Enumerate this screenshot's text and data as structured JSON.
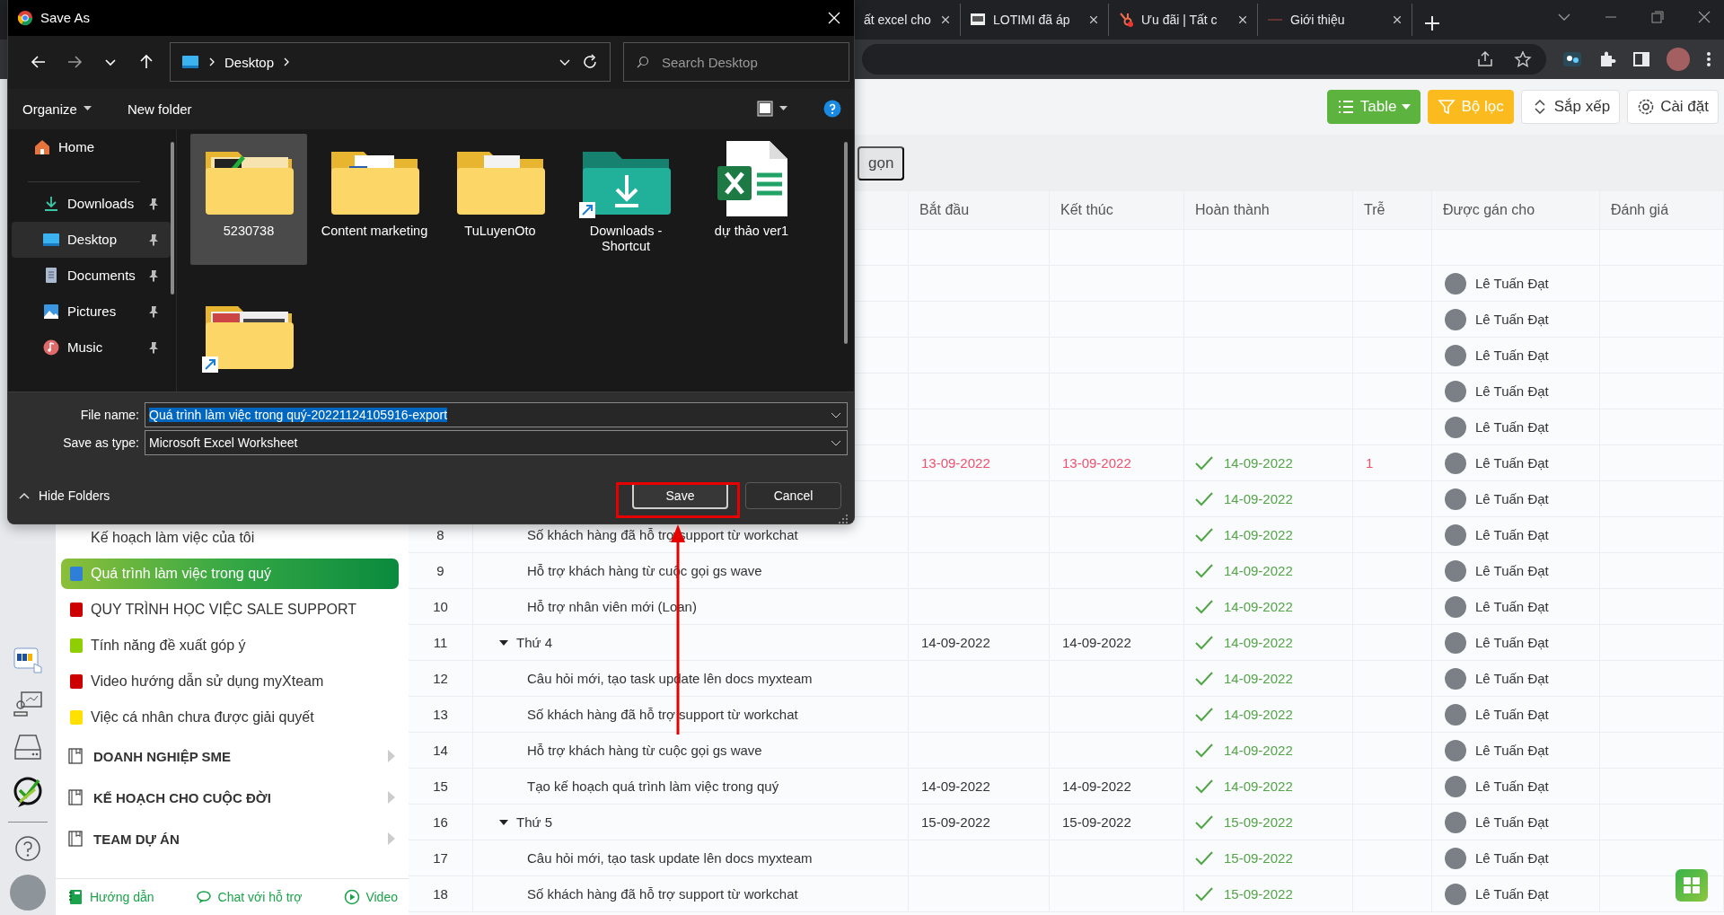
{
  "browser": {
    "tabs": [
      {
        "title": "ất excel cho",
        "selected": false
      },
      {
        "title": "LOTIMI đã áp",
        "selected": false
      },
      {
        "title": "Ưu đãi | Tất c",
        "selected": false
      },
      {
        "title": "Giới thiệu",
        "selected": false
      }
    ]
  },
  "app": {
    "toolbar": [
      {
        "label": "Table",
        "kind": "primary",
        "caret": true
      },
      {
        "label": "Bộ lọc",
        "kind": "warning",
        "caret": false
      },
      {
        "label": "Sắp xếp",
        "kind": "default",
        "caret": false
      },
      {
        "label": "Cài đặt",
        "kind": "default",
        "caret": false
      }
    ],
    "collapse_button": "gọn",
    "sidebar": {
      "items": [
        {
          "label": "Kế hoạch làm việc của tôi",
          "selected": false
        },
        {
          "label": "Quá trình làm việc trong quý",
          "color": "#2f7fd8",
          "selected": true
        },
        {
          "label": "QUY TRÌNH HỌC VIỆC SALE SUPPORT",
          "color": "#cc0000",
          "selected": false
        },
        {
          "label": "Tính năng đề xuất góp ý",
          "color": "#8fce00",
          "selected": false
        },
        {
          "label": "Video hướng dẫn sử dụng myXteam",
          "color": "#cc0000",
          "selected": false
        },
        {
          "label": "Việc cá nhân chưa được giải quyết",
          "color": "#ffe000",
          "selected": false
        }
      ],
      "sections": [
        {
          "label": "DOANH NGHIỆP SME",
          "expanded": false
        },
        {
          "label": "KẾ HOẠCH CHO CUỘC ĐỜI",
          "expanded": false
        },
        {
          "label": "TEAM DỰ ÁN",
          "expanded": false
        }
      ],
      "footer": [
        {
          "label": "Hướng dẫn"
        },
        {
          "label": "Chat với hỗ trợ"
        },
        {
          "label": "Video"
        }
      ]
    },
    "table": {
      "columns": [
        "Bắt đầu",
        "Kết thúc",
        "Hoàn thành",
        "Trễ",
        "Được gán cho",
        "Đánh giá"
      ],
      "rows": [
        {
          "kind": "task"
        },
        {
          "kind": "task",
          "assignee": "Lê Tuấn Đạt"
        },
        {
          "kind": "task",
          "assignee": "Lê Tuấn Đạt"
        },
        {
          "kind": "task",
          "assignee": "Lê Tuấn Đạt"
        },
        {
          "kind": "task",
          "assignee": "Lê Tuấn Đạt"
        },
        {
          "kind": "task",
          "assignee": "Lê Tuấn Đạt"
        },
        {
          "kind": "task",
          "start": "13-09-2022",
          "end": "13-09-2022",
          "overdue": true,
          "done": "14-09-2022",
          "late": "1",
          "assignee": "Lê Tuấn Đạt"
        },
        {
          "kind": "task",
          "done": "14-09-2022",
          "assignee": "Lê Tuấn Đạt"
        },
        {
          "kind": "task",
          "number": "8",
          "name": "Số khách hàng đã hỗ trợ support từ workchat",
          "done": "14-09-2022",
          "assignee": "Lê Tuấn Đạt"
        },
        {
          "kind": "task",
          "number": "9",
          "name": "Hỗ trợ khách hàng từ cuộc gọi gs wave",
          "done": "14-09-2022",
          "assignee": "Lê Tuấn Đạt"
        },
        {
          "kind": "task",
          "number": "10",
          "name": "Hỗ trợ nhân viên mới (Loan)",
          "done": "14-09-2022",
          "assignee": "Lê Tuấn Đạt"
        },
        {
          "kind": "group",
          "number": "11",
          "name": "Thứ 4",
          "expanded": true,
          "start": "14-09-2022",
          "end": "14-09-2022",
          "overdue": false,
          "done": "14-09-2022",
          "assignee": "Lê Tuấn Đạt"
        },
        {
          "kind": "task",
          "number": "12",
          "name": "Câu hỏi mới, tạo task update lên docs myxteam",
          "done": "14-09-2022",
          "assignee": "Lê Tuấn Đạt"
        },
        {
          "kind": "task",
          "number": "13",
          "name": "Số khách hàng đã hỗ trợ support từ workchat",
          "done": "14-09-2022",
          "assignee": "Lê Tuấn Đạt"
        },
        {
          "kind": "task",
          "number": "14",
          "name": "Hỗ trợ khách hàng từ cuộc gọi gs wave",
          "done": "14-09-2022",
          "assignee": "Lê Tuấn Đạt"
        },
        {
          "kind": "task",
          "number": "15",
          "name": "Tạo kế hoạch quá trình làm việc trong quý",
          "start": "14-09-2022",
          "end": "14-09-2022",
          "overdue": false,
          "done": "14-09-2022",
          "assignee": "Lê Tuấn Đạt"
        },
        {
          "kind": "group",
          "number": "16",
          "name": "Thứ 5",
          "expanded": true,
          "start": "15-09-2022",
          "end": "15-09-2022",
          "overdue": false,
          "done": "15-09-2022",
          "assignee": "Lê Tuấn Đạt"
        },
        {
          "kind": "task",
          "number": "17",
          "name": "Câu hỏi mới, tạo task update lên docs myxteam",
          "done": "15-09-2022",
          "assignee": "Lê Tuấn Đạt"
        },
        {
          "kind": "task",
          "number": "18",
          "name": "Số khách hàng đã hỗ trợ support từ workchat",
          "done": "15-09-2022",
          "assignee": "Lê Tuấn Đạt"
        }
      ]
    }
  },
  "dialog": {
    "title": "Save As",
    "path": [
      "Desktop"
    ],
    "search": {
      "placeholder": "Search Desktop"
    },
    "commands": [
      {
        "label": "Organize",
        "menu": true
      },
      {
        "label": "New folder",
        "menu": false
      }
    ],
    "nav": [
      {
        "label": "Home",
        "pinned": false,
        "selected": false
      },
      {
        "label": "Downloads",
        "pinned": true,
        "selected": false
      },
      {
        "label": "Desktop",
        "pinned": true,
        "selected": true
      },
      {
        "label": "Documents",
        "pinned": true,
        "selected": false
      },
      {
        "label": "Pictures",
        "pinned": true,
        "selected": false
      },
      {
        "label": "Music",
        "pinned": true,
        "selected": false
      }
    ],
    "files": [
      {
        "label": "5230738",
        "kind": "image-folder",
        "selected": true
      },
      {
        "label": "Content marketing",
        "kind": "word-folder",
        "selected": false
      },
      {
        "label": "TuLuyenOto",
        "kind": "file-folder",
        "selected": false
      },
      {
        "label": "Downloads - Shortcut",
        "kind": "download-shortcut",
        "selected": false
      },
      {
        "label": "dự thảo ver1",
        "kind": "excel",
        "selected": false
      },
      {
        "kind": "folder-shortcut",
        "selected": false
      }
    ],
    "file_name_label": "File name:",
    "file_name": "Quá trình làm việc trong quý-20221124105916-export",
    "type_label": "Save as type:",
    "type": "Microsoft Excel Worksheet",
    "hide_folders": "Hide Folders",
    "buttons": [
      {
        "label": "Save",
        "kind": "default"
      },
      {
        "label": "Cancel",
        "kind": "normal"
      }
    ]
  }
}
